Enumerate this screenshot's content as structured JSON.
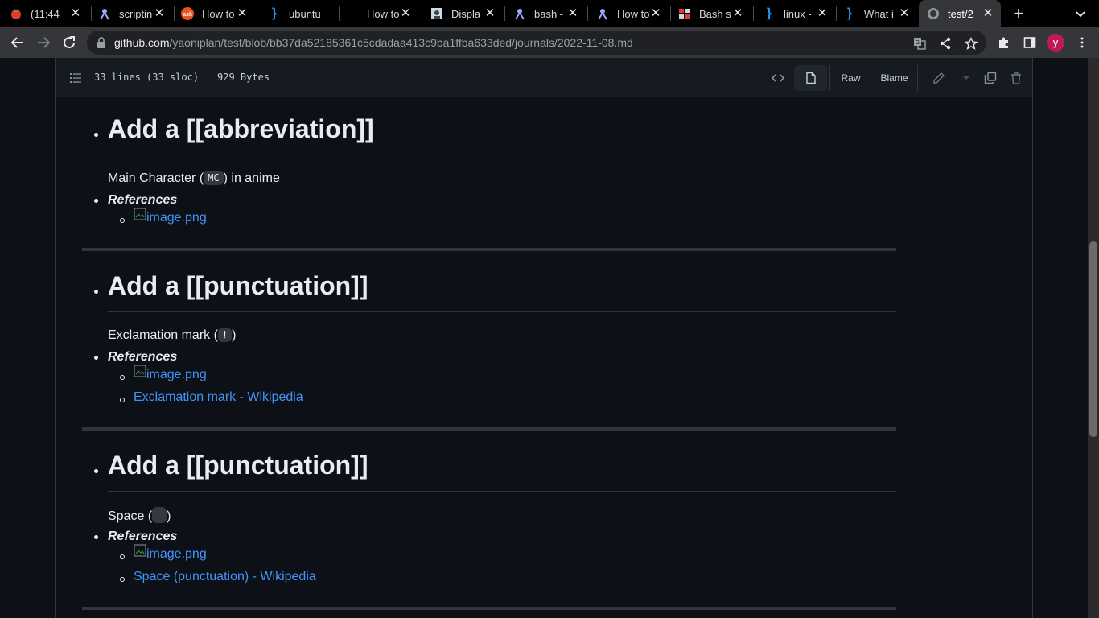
{
  "browser": {
    "tabs": [
      {
        "title": "(11:44",
        "icon": "tomato-timer-icon",
        "color": "#e53935"
      },
      {
        "title": "scriptin",
        "icon": "askubuntu-icon",
        "color": "#7a7aff"
      },
      {
        "title": "How to",
        "icon": "askfm-icon",
        "color": "#e8531e"
      },
      {
        "title": "ubuntu",
        "icon": "codeproject-icon",
        "color": "#2196f3"
      },
      {
        "title": "How to",
        "icon": "blank-icon",
        "color": "#000000"
      },
      {
        "title": "Displa",
        "icon": "blog-icon",
        "color": "#cfd8dc"
      },
      {
        "title": "bash -",
        "icon": "askubuntu-icon",
        "color": "#7a7aff"
      },
      {
        "title": "How to",
        "icon": "askubuntu-icon",
        "color": "#7a7aff"
      },
      {
        "title": "Bash s",
        "icon": "ss64-icon",
        "color": "#e53935"
      },
      {
        "title": "linux -",
        "icon": "codeproject-icon",
        "color": "#2196f3"
      },
      {
        "title": "What i",
        "icon": "codeproject-icon",
        "color": "#2196f3"
      },
      {
        "title": "test/2",
        "icon": "github-icon",
        "color": "#8b949e",
        "active": true
      }
    ],
    "url_host": "github.com",
    "url_path": "/yaoniplan/test/blob/bb37da52185361c5cdadaa413c9ba1ffba633ded/journals/2022-11-08.md",
    "profile_initial": "y"
  },
  "file": {
    "lines": "33 lines (33 sloc)",
    "size": "929 Bytes",
    "raw_label": "Raw",
    "blame_label": "Blame"
  },
  "markdown": {
    "sections": [
      {
        "heading": "Add a [[abbreviation]]",
        "text_before": "Main Character (",
        "code": "MC",
        "text_after": ") in anime",
        "refs_label": "References",
        "links": [
          "image.png"
        ]
      },
      {
        "heading": "Add a [[punctuation]]",
        "text_before": "Exclamation mark (",
        "code": "!",
        "text_after": ")",
        "refs_label": "References",
        "links": [
          "image.png",
          "Exclamation mark - Wikipedia"
        ]
      },
      {
        "heading": "Add a [[punctuation]]",
        "text_before": "Space (",
        "code": " ",
        "text_after": ")",
        "refs_label": "References",
        "links": [
          "image.png",
          "Space (punctuation) - Wikipedia"
        ]
      }
    ]
  }
}
